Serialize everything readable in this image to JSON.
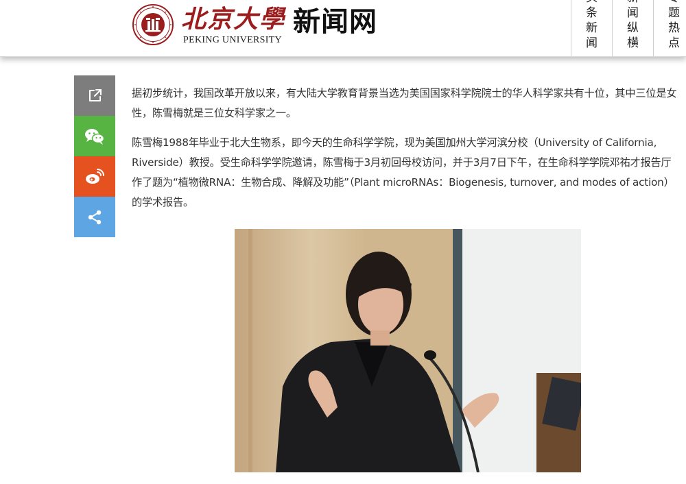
{
  "header": {
    "logo_cn": "北京大學",
    "logo_en": "PEKING UNIVERSITY",
    "site_title": "新闻网",
    "nav": [
      {
        "label": "头条新闻"
      },
      {
        "label": "新闻纵横"
      },
      {
        "label": "专题热点"
      }
    ]
  },
  "share_bar": {
    "buttons": [
      {
        "icon": "share-external-icon",
        "color": "#7d7d7d"
      },
      {
        "icon": "wechat-icon",
        "color": "#57b342"
      },
      {
        "icon": "weibo-icon",
        "color": "#e5521f"
      },
      {
        "icon": "share-icon",
        "color": "#5ea6e3"
      }
    ]
  },
  "article": {
    "paragraphs": [
      "据初步统计，我国改革开放以来，有大陆大学教育背景当选为美国国家科学院院士的华人科学家共有十位，其中三位是女性，陈雪梅就是三位女科学家之一。",
      "陈雪梅1988年毕业于北大生物系，即今天的生命科学学院，现为美国加州大学河滨分校（University of California, Riverside）教授。受生命科学学院邀请，陈雪梅于3月初回母校访问，并于3月7日下午，在生命科学学院邓祐才报告厅作了题为“植物微RNA：生物合成、降解及功能”（Plant microRNAs：Biogenesis, turnover, and modes of action）的学术报告。"
    ],
    "photo": {
      "description": "woman speaking at a podium microphone"
    }
  },
  "colors": {
    "seal_red": "#9b1d1d",
    "text": "#333333"
  }
}
